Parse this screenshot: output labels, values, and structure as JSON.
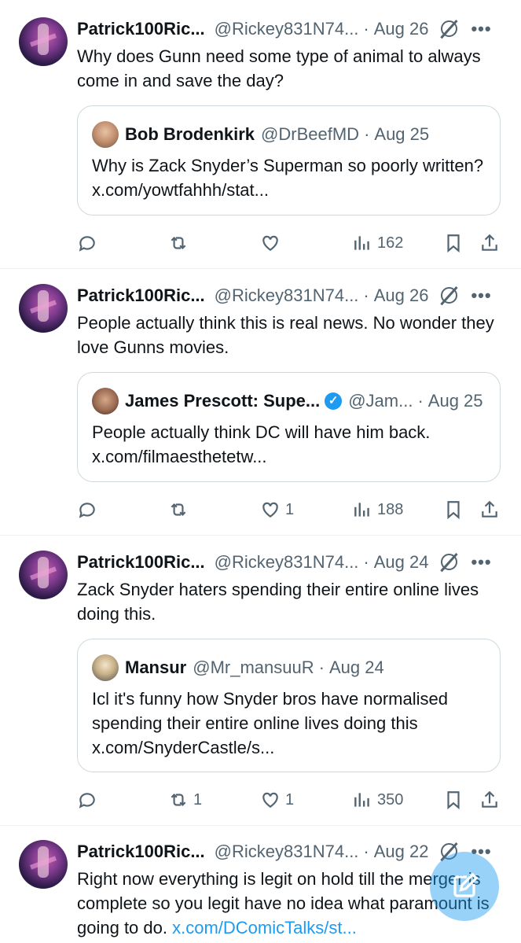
{
  "tweets": [
    {
      "name": "Patrick100Ric...",
      "handle": "@Rickey831N74...",
      "dot": "·",
      "date": "Aug 26",
      "text": "Why does Gunn need some type of animal to always come in and save the day?",
      "link": "",
      "quote": {
        "name": "Bob Brodenkirk",
        "handle": "@DrBeefMD",
        "dot": "·",
        "date": "Aug 25",
        "verified": false,
        "text": "Why is Zack Snyder’s Superman so poorly written? x.com/yowtfahhh/stat..."
      },
      "replies": "",
      "reposts": "",
      "likes": "",
      "views": "162"
    },
    {
      "name": "Patrick100Ric...",
      "handle": "@Rickey831N74...",
      "dot": "·",
      "date": "Aug 26",
      "text": "People actually think this is real news. No wonder they love Gunns movies.",
      "link": "",
      "quote": {
        "name": "James Prescott: Supe...",
        "handle": "@Jam...",
        "dot": "·",
        "date": "Aug 25",
        "verified": true,
        "text": "People actually think DC will have him back. x.com/filmaesthetetw..."
      },
      "replies": "",
      "reposts": "",
      "likes": "1",
      "views": "188"
    },
    {
      "name": "Patrick100Ric...",
      "handle": "@Rickey831N74...",
      "dot": "·",
      "date": "Aug 24",
      "text": "Zack Snyder haters spending their entire online lives doing this.",
      "link": "",
      "quote": {
        "name": "Mansur",
        "handle": "@Mr_mansuuR",
        "dot": "·",
        "date": "Aug 24",
        "verified": false,
        "text": "Icl it's funny how Snyder bros have normalised spending their entire online lives doing this x.com/SnyderCastle/s..."
      },
      "replies": "",
      "reposts": "1",
      "likes": "1",
      "views": "350"
    },
    {
      "name": "Patrick100Ric...",
      "handle": "@Rickey831N74...",
      "dot": "·",
      "date": "Aug 22",
      "text": "Right now everything is legit on hold till the merger is complete so you legit have no idea what paramount is going to do. ",
      "link": "x.com/DComicTalks/st...",
      "quote": null
    }
  ],
  "more_label": "•••",
  "colors": {
    "accent": "#1d9bf0",
    "muted": "#536471",
    "text": "#0f1419",
    "border": "#cfd9de"
  },
  "icons": [
    "grok-icon",
    "more-icon",
    "reply-icon",
    "repost-icon",
    "like-icon",
    "views-icon",
    "bookmark-icon",
    "share-icon",
    "compose-icon",
    "verified-icon"
  ]
}
